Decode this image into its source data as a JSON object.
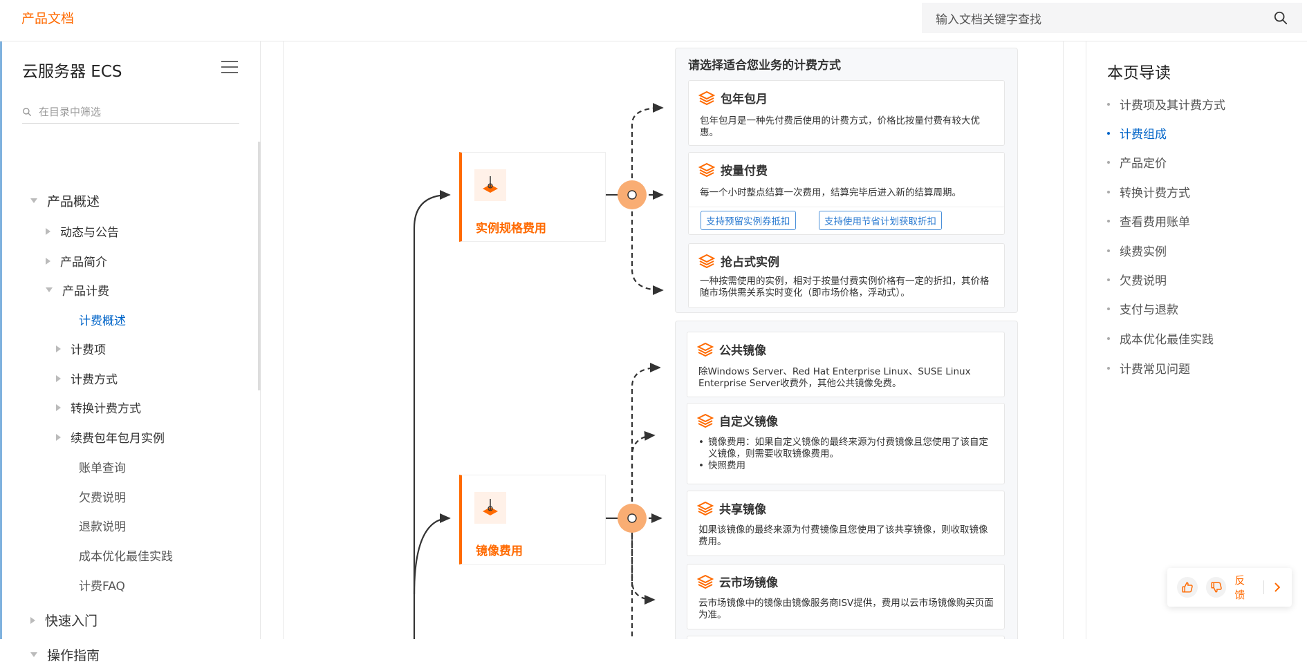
{
  "header": {
    "brand": "产品文档",
    "search_placeholder": "输入文档关键字查找"
  },
  "sidebar": {
    "title": "云服务器 ECS",
    "filter_placeholder": "在目录中筛选",
    "items": [
      {
        "label": "产品概述",
        "level": 0,
        "arrow": "down"
      },
      {
        "label": "动态与公告",
        "level": 1,
        "arrow": "right"
      },
      {
        "label": "产品简介",
        "level": 1,
        "arrow": "right"
      },
      {
        "label": "产品计费",
        "level": 1,
        "arrow": "down"
      },
      {
        "label": "计费概述",
        "level": 2,
        "arrow": "none",
        "active": true
      },
      {
        "label": "计费项",
        "level": 2,
        "arrow": "right"
      },
      {
        "label": "计费方式",
        "level": 2,
        "arrow": "right"
      },
      {
        "label": "转换计费方式",
        "level": 2,
        "arrow": "right"
      },
      {
        "label": "续费包年包月实例",
        "level": 2,
        "arrow": "right"
      },
      {
        "label": "账单查询",
        "level": 2,
        "arrow": "none"
      },
      {
        "label": "欠费说明",
        "level": 2,
        "arrow": "none"
      },
      {
        "label": "退款说明",
        "level": 2,
        "arrow": "none"
      },
      {
        "label": "成本优化最佳实践",
        "level": 2,
        "arrow": "none"
      },
      {
        "label": "计费FAQ",
        "level": 2,
        "arrow": "none"
      },
      {
        "label": "快速入门",
        "level": 0,
        "arrow": "right"
      },
      {
        "label": "操作指南",
        "level": 0,
        "arrow": "down"
      }
    ]
  },
  "diagram": {
    "instance_fee": {
      "label": "实例规格费用",
      "panel_title": "请选择适合您业务的计费方式",
      "cards": [
        {
          "title": "包年包月",
          "desc": "包年包月是一种先付费后使用的计费方式，价格比按量付费有较大优惠。"
        },
        {
          "title": "按量付费",
          "desc": "每一个小时整点结算一次费用，结算完毕后进入新的结算周期。",
          "tags": [
            "支持预留实例券抵扣",
            "支持使用节省计划获取折扣"
          ]
        },
        {
          "title": "抢占式实例",
          "desc": "一种按需使用的实例，相对于按量付费实例价格有一定的折扣，其价格随市场供需关系实时变化（即市场价格，浮动式）。"
        }
      ]
    },
    "image_fee": {
      "label": "镜像费用",
      "cards": [
        {
          "title": "公共镜像",
          "desc": "除Windows Server、Red Hat Enterprise Linux、SUSE Linux Enterprise Server收费外，其他公共镜像免费。"
        },
        {
          "title": "自定义镜像",
          "bullets": [
            "镜像费用：如果自定义镜像的最终来源为付费镜像且您使用了该自定义镜像，则需要收取镜像费用。",
            "快照费用"
          ]
        },
        {
          "title": "共享镜像",
          "desc": "如果该镜像的最终来源为付费镜像且您使用了该共享镜像，则收取镜像费用。"
        },
        {
          "title": "云市场镜像",
          "desc": "云市场镜像中的镜像由镜像服务商ISV提供，费用以云市场镜像购买页面为准。"
        }
      ]
    }
  },
  "toc": {
    "title": "本页导读",
    "items": [
      {
        "label": "计费项及其计费方式"
      },
      {
        "label": "计费组成",
        "active": true
      },
      {
        "label": "产品定价"
      },
      {
        "label": "转换计费方式"
      },
      {
        "label": "查看费用账单"
      },
      {
        "label": "续费实例"
      },
      {
        "label": "欠费说明"
      },
      {
        "label": "支付与退款"
      },
      {
        "label": "成本优化最佳实践"
      },
      {
        "label": "计费常见问题"
      }
    ]
  },
  "feedback": {
    "label": "反馈"
  },
  "colors": {
    "accent": "#ff6a00",
    "link": "#0064c8",
    "tag": "#2a7ad1"
  }
}
